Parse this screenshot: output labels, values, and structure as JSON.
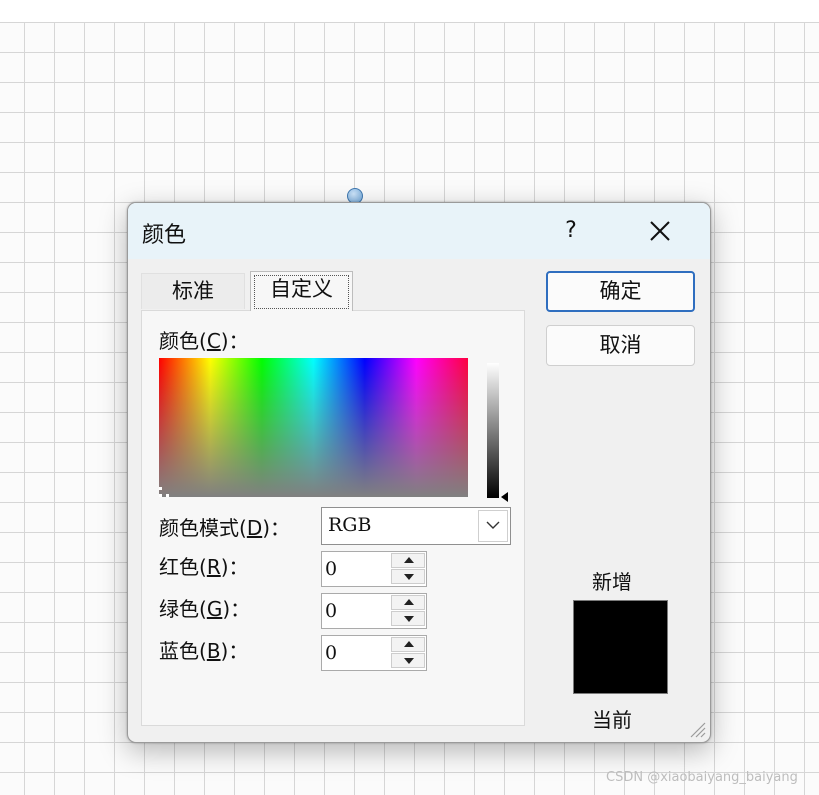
{
  "window": {
    "title": "颜色",
    "help_label": "?"
  },
  "tabs": [
    {
      "label": "标准",
      "active": false
    },
    {
      "label": "自定义",
      "active": true
    }
  ],
  "custom": {
    "color_label": "颜色",
    "color_key": "C",
    "mode_label": "颜色模式",
    "mode_key": "D",
    "mode_value": "RGB",
    "red_label": "红色",
    "red_key": "R",
    "red_value": "0",
    "green_label": "绿色",
    "green_key": "G",
    "green_value": "0",
    "blue_label": "蓝色",
    "blue_key": "B",
    "blue_value": "0"
  },
  "buttons": {
    "ok": "确定",
    "cancel": "取消"
  },
  "preview": {
    "new_label": "新增",
    "current_label": "当前",
    "new_color": "#000000",
    "current_color": "#000000"
  },
  "icons": {
    "close": "close-icon",
    "dropdown": "chevron-down-icon",
    "spin_up": "spin-up-icon",
    "spin_down": "spin-down-icon",
    "resize": "resize-grip-icon"
  },
  "watermark": "CSDN @xiaobaiyang_baiyang"
}
